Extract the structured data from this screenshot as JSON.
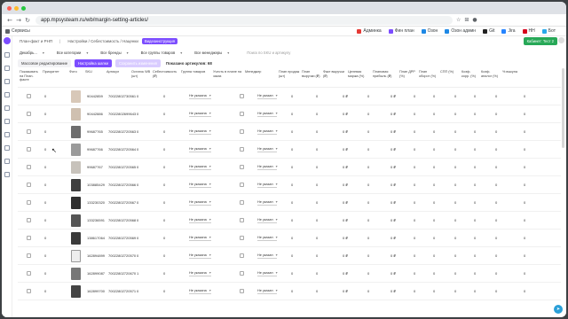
{
  "browser": {
    "url": "app.mpsysteam.ru/wb/margin-setting-articles/",
    "bookmarks_label": "Сервисы",
    "bookmarks": [
      "Админка",
      "Фин план",
      "Озон",
      "Озон админ",
      "Git",
      "Jira",
      "HH",
      "Бот"
    ]
  },
  "topbar": {
    "crumb1": "План-факт и РНП",
    "crumb2": "Настройки / Себестоимость / Наценки",
    "chip": "Видеоинструкция",
    "cabinet_button": "Кабинет: Тест 2"
  },
  "filters": {
    "date": "Декабрь...",
    "category": "Все категории",
    "brands": "Все бренды",
    "groups": "Все группы товаров",
    "managers": "Все менеджеры",
    "search_placeholder": "Поиск по SKU и артикулу"
  },
  "actions": {
    "mass_edit": "Массовое редактирование",
    "settings_hats": "Настройка шапки",
    "save_changes": "Сохранить изменения",
    "shown": "Показано артикулов: 68"
  },
  "columns": [
    "Показывать на План-факте",
    "Приоритет",
    "Фото",
    "SKU",
    "Артикул",
    "Остаток WB (шт)",
    "Себестоимость (₽)",
    "Группа товаров",
    "Учесть в плане на заказ",
    "Менеджер",
    "План продаж (шт)",
    "План выручки (₽)",
    "Факт выручки (₽)",
    "Целевая маржа (%)",
    "Плановая прибыль (₽)",
    "План ДРР (%)",
    "План оборот (%)",
    "СПП (%)",
    "Коэф. корр. (%)",
    "Коэф. аналог (%)",
    "% выкупа"
  ],
  "rows": [
    {
      "priority": "0",
      "sku": "90442859",
      "article": "70022802730561",
      "stock": "0",
      "cost": "0",
      "group": "Не указана",
      "manager": "Не указан",
      "plan": "0",
      "rev": "0",
      "fact": "0 ₽",
      "margin": "0",
      "profit": "0 ₽",
      "drr": "0",
      "turn": "0",
      "spp": "0",
      "k1": "0",
      "k2": "0",
      "buyout": "0"
    },
    {
      "priority": "0",
      "sku": "90442886",
      "article": "70022802699643",
      "stock": "0",
      "cost": "0",
      "group": "Не указана",
      "manager": "Не указан",
      "plan": "0",
      "rev": "0",
      "fact": "0 ₽",
      "margin": "0",
      "profit": "0 ₽",
      "drr": "0",
      "turn": "0",
      "spp": "0",
      "k1": "0",
      "k2": "0",
      "buyout": "0"
    },
    {
      "priority": "0",
      "sku": "99687765",
      "article": "70022802720563",
      "stock": "0",
      "cost": "0",
      "group": "Не указана",
      "manager": "Не указан",
      "plan": "0",
      "rev": "0",
      "fact": "0 ₽",
      "margin": "0",
      "profit": "0 ₽",
      "drr": "0",
      "turn": "0",
      "spp": "0",
      "k1": "0",
      "k2": "0",
      "buyout": "0"
    },
    {
      "priority": "0",
      "sku": "99687766",
      "article": "70022802720564",
      "stock": "0",
      "cost": "0",
      "group": "Не указана",
      "manager": "Не указан",
      "plan": "0",
      "rev": "0",
      "fact": "0 ₽",
      "margin": "0",
      "profit": "0 ₽",
      "drr": "0",
      "turn": "0",
      "spp": "0",
      "k1": "0",
      "k2": "0",
      "buyout": "0"
    },
    {
      "priority": "0",
      "sku": "99687767",
      "article": "70022802720565",
      "stock": "0",
      "cost": "0",
      "group": "Не указана",
      "manager": "Не указан",
      "plan": "0",
      "rev": "0",
      "fact": "0 ₽",
      "margin": "0",
      "profit": "0 ₽",
      "drr": "0",
      "turn": "0",
      "spp": "0",
      "k1": "0",
      "k2": "0",
      "buyout": "0"
    },
    {
      "priority": "0",
      "sku": "103885429",
      "article": "70022802720566",
      "stock": "0",
      "cost": "0",
      "group": "Не указана",
      "manager": "Не указан",
      "plan": "0",
      "rev": "0",
      "fact": "0 ₽",
      "margin": "0",
      "profit": "0 ₽",
      "drr": "0",
      "turn": "0",
      "spp": "0",
      "k1": "0",
      "k2": "0",
      "buyout": "0"
    },
    {
      "priority": "0",
      "sku": "133230320",
      "article": "70022802720567",
      "stock": "0",
      "cost": "0",
      "group": "Не указана",
      "manager": "Не указан",
      "plan": "0",
      "rev": "0",
      "fact": "0 ₽",
      "margin": "0",
      "profit": "0 ₽",
      "drr": "0",
      "turn": "0",
      "spp": "0",
      "k1": "0",
      "k2": "0",
      "buyout": "0"
    },
    {
      "priority": "0",
      "sku": "133236591",
      "article": "70022802720568",
      "stock": "0",
      "cost": "0",
      "group": "Не указана",
      "manager": "Не указан",
      "plan": "0",
      "rev": "0",
      "fact": "0 ₽",
      "margin": "0",
      "profit": "0 ₽",
      "drr": "0",
      "turn": "0",
      "spp": "0",
      "k1": "0",
      "k2": "0",
      "buyout": "0"
    },
    {
      "priority": "0",
      "sku": "138617064",
      "article": "70022802720569",
      "stock": "0",
      "cost": "0",
      "group": "Не указана",
      "manager": "Не указан",
      "plan": "0",
      "rev": "0",
      "fact": "0 ₽",
      "margin": "0",
      "profit": "0 ₽",
      "drr": "0",
      "turn": "0",
      "spp": "0",
      "k1": "0",
      "k2": "0",
      "buyout": "0"
    },
    {
      "priority": "0",
      "sku": "162894899",
      "article": "70022802720570",
      "stock": "0",
      "cost": "0",
      "group": "Не указана",
      "manager": "Не указан",
      "plan": "0",
      "rev": "0",
      "fact": "0 ₽",
      "margin": "0",
      "profit": "0 ₽",
      "drr": "0",
      "turn": "0",
      "spp": "0",
      "k1": "0",
      "k2": "0",
      "buyout": "0"
    },
    {
      "priority": "0",
      "sku": "162899087",
      "article": "70022802720670",
      "stock": "1",
      "cost": "0",
      "group": "Не указана",
      "manager": "Не указан",
      "plan": "0",
      "rev": "0",
      "fact": "0 ₽",
      "margin": "0",
      "profit": "0 ₽",
      "drr": "0",
      "turn": "0",
      "spp": "0",
      "k1": "0",
      "k2": "0",
      "buyout": "0"
    },
    {
      "priority": "0",
      "sku": "162899700",
      "article": "70022802720571",
      "stock": "0",
      "cost": "0",
      "group": "Не указана",
      "manager": "Не указан",
      "plan": "0",
      "rev": "0",
      "fact": "0 ₽",
      "margin": "0",
      "profit": "0 ₽",
      "drr": "0",
      "turn": "0",
      "spp": "0",
      "k1": "0",
      "k2": "0",
      "buyout": "0"
    }
  ]
}
